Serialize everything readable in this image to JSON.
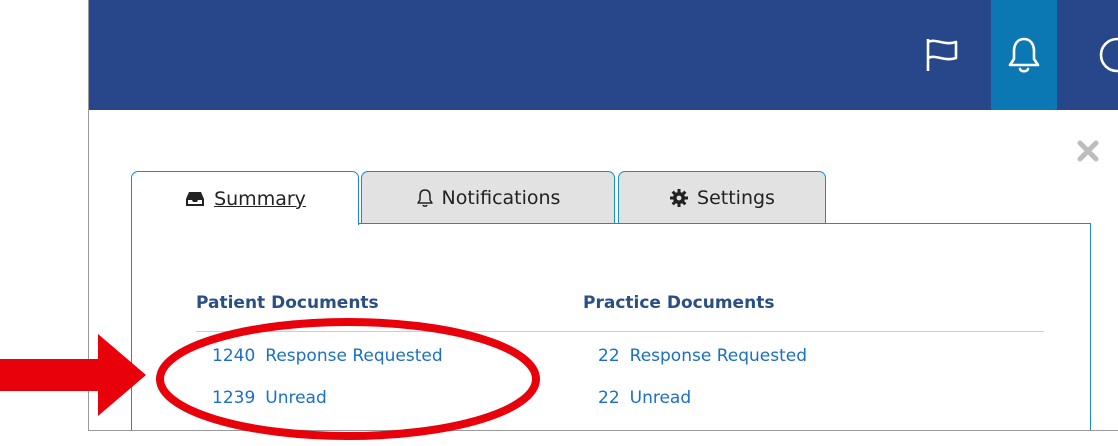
{
  "header": {
    "actions": [
      {
        "name": "flag-button",
        "icon": "flag-icon",
        "active": false
      },
      {
        "name": "notifications-bell-button",
        "icon": "bell-icon",
        "active": true
      },
      {
        "name": "help-button",
        "icon": "circle-icon",
        "active": false
      }
    ]
  },
  "dialog": {
    "close_icon": "close-icon",
    "tabs": [
      {
        "label": "Summary",
        "icon": "inbox-icon",
        "active": true
      },
      {
        "label": "Notifications",
        "icon": "bell-icon",
        "active": false
      },
      {
        "label": "Settings",
        "icon": "gear-icon",
        "active": false
      }
    ],
    "summary": {
      "patient": {
        "heading": "Patient Documents",
        "items": [
          {
            "count": "1240",
            "label": "Response Requested"
          },
          {
            "count": "1239",
            "label": "Unread"
          }
        ]
      },
      "practice": {
        "heading": "Practice Documents",
        "items": [
          {
            "count": "22",
            "label": "Response Requested"
          },
          {
            "count": "22",
            "label": "Unread"
          }
        ]
      }
    }
  },
  "annotation": {
    "arrow_color": "#e8000b",
    "ellipse_color": "#e8000b"
  },
  "colors": {
    "header_bg": "#27478a",
    "active_header_button": "#0b78b4",
    "tab_border": "#1a8fbf",
    "heading_text": "#2a4f86",
    "link_text": "#1a6fc9"
  }
}
